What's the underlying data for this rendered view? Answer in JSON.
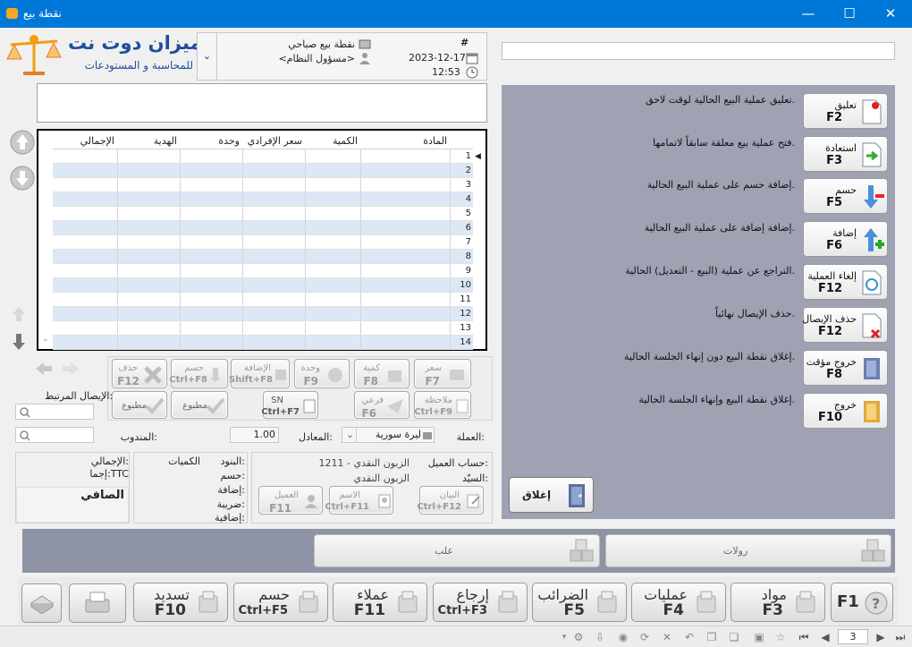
{
  "window": {
    "title": "نقطة بيع",
    "minimize": "—",
    "maximize": "☐",
    "close": "✕"
  },
  "logo": {
    "brand": "الميزان دوت نت",
    "tagline": "للمحاسبة و المستودعات"
  },
  "header": {
    "hash": "#",
    "pos_name": "نقطة بيع صباحي",
    "user": "<مسؤول النظام>",
    "date": "2023-12-17",
    "time": "12:53"
  },
  "grid": {
    "columns": [
      "المادة",
      "الكمية",
      "سعر الإفرادي",
      "وحدة",
      "الهدية",
      "الإجمالي"
    ],
    "row_numbers": [
      "1",
      "2",
      "3",
      "4",
      "5",
      "6",
      "7",
      "8",
      "9",
      "10",
      "11",
      "12",
      "13",
      "14"
    ]
  },
  "edit_buttons": {
    "price": {
      "label": "سعر",
      "key": "F7"
    },
    "qty": {
      "label": "كمية",
      "key": "F8"
    },
    "unit": {
      "label": "وحدة",
      "key": "F9"
    },
    "addition": {
      "label": "الإضافة",
      "key": "Shift+F8"
    },
    "discount": {
      "label": "حسم",
      "key": "Ctrl+F8"
    },
    "delete": {
      "label": "حذف",
      "key": "F12"
    },
    "note": {
      "label": "ملاحظة",
      "key": "Ctrl+F9"
    },
    "sub": {
      "label": "فرعي",
      "key": "F6"
    },
    "sn": {
      "label": "SN",
      "key": "Ctrl+F7"
    },
    "printed1": "مطبوع",
    "printed2": "مطبوع"
  },
  "fields": {
    "linked_receipt": "الإيصال المرتبط:",
    "currency_label": "العملة:",
    "currency_value": "ليرة سورية",
    "rate_label": "المعادل:",
    "rate_value": "1.00",
    "rep_label": "المندوب:"
  },
  "customer": {
    "account_label": "حساب العميل:",
    "account_value": "1211 - الزبون النقدي",
    "mr_label": "السيّد:",
    "mr_value": "الزبون النقدي",
    "statement": {
      "label": "البيان",
      "key": "Ctrl+F12"
    },
    "name": {
      "label": "الاسم",
      "key": "Ctrl+F11"
    },
    "client": {
      "label": "العميل",
      "key": "F11"
    }
  },
  "summary": {
    "items": "البنود:",
    "quantities": "الكميات",
    "discount": "حسم:",
    "addition": "إضافة:",
    "tax": "ضريبة:",
    "additional": "إضافية:",
    "total": "الإجمالي:",
    "total_ttc": "إجما:TTC",
    "net": "الصافي"
  },
  "actions": [
    {
      "label": "تعليق",
      "key": "F2",
      "desc": "تعليق عملية البيع الحالية لوقت لاحق."
    },
    {
      "label": "استعادة",
      "key": "F3",
      "desc": "فتح عملية بيع معلقة سابقاً لاتمامها."
    },
    {
      "label": "حسم",
      "key": "F5",
      "desc": "إضافة حسم على عملية البيع الحالية."
    },
    {
      "label": "إضافة",
      "key": "F6",
      "desc": "إضافة إضافة على عملية البيع الحالية."
    },
    {
      "label": "إلغاء العملية",
      "key": "F12",
      "desc": "التراجع عن عملية (البيع - التعديل) الحالية."
    },
    {
      "label": "حذف الإيصال",
      "key": "F12",
      "desc": "حذف الإيصال نهائياً."
    },
    {
      "label": "خروج مؤقت",
      "key": "F8",
      "desc": "إغلاق نقطة البيع دون إنهاء الجلسة الحالية."
    },
    {
      "label": "خروج",
      "key": "F10",
      "desc": "إغلاق نقطة البيع وإنهاء الجلسة الحالية."
    }
  ],
  "close_button": "إغلاق",
  "category_tabs": {
    "left": "علب",
    "right": "رولات"
  },
  "bottom_bar": [
    {
      "label": "",
      "key": "F1"
    },
    {
      "label": "مواد",
      "key": "F3"
    },
    {
      "label": "عمليات",
      "key": "F4"
    },
    {
      "label": "الضرائب",
      "key": "F5"
    },
    {
      "label": "إرجاع",
      "key": "Ctrl+F3"
    },
    {
      "label": "عملاء",
      "key": "F11"
    },
    {
      "label": "حسم",
      "key": "Ctrl+F5"
    },
    {
      "label": "تسديد",
      "key": "F10"
    }
  ],
  "statusbar": {
    "page": "3"
  },
  "colors": {
    "titlebar": "#0078d7",
    "right_panel": "#9ea2b2",
    "bottom_panel": "#8e93a6",
    "alt_row": "#dde8f6"
  }
}
